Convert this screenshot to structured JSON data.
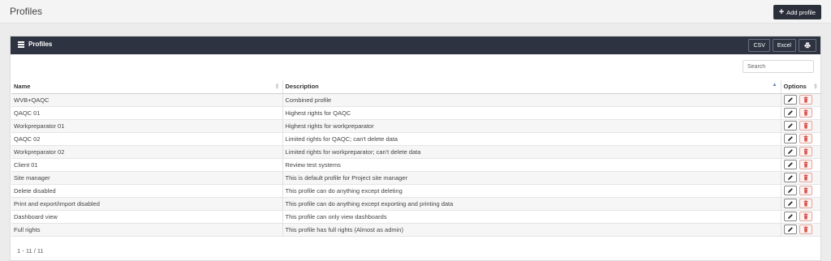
{
  "header": {
    "title": "Profiles",
    "add_button_icon": "plus-icon",
    "add_button_label": "Add profile"
  },
  "panel": {
    "title": "Profiles",
    "title_icon": "list-icon",
    "buttons": {
      "csv": "CSV",
      "excel": "Excel",
      "print_icon": "print-icon"
    }
  },
  "search": {
    "placeholder": "Search"
  },
  "table": {
    "columns": {
      "name": "Name",
      "description": "Description",
      "options": "Options"
    },
    "sorted_column": "Description",
    "rows": [
      {
        "name": "WVB+QAQC",
        "description": "Combined profile"
      },
      {
        "name": "QAQC 01",
        "description": "Highest rights for QAQC"
      },
      {
        "name": "Workpreparator 01",
        "description": "Highest rights for workpreparator"
      },
      {
        "name": "QAQC 02",
        "description": "Limited rights for QAQC; can't delete data"
      },
      {
        "name": "Workpreparator 02",
        "description": "Limited rights for workpreparator; can't delete data"
      },
      {
        "name": "Client 01",
        "description": "Review test systems"
      },
      {
        "name": "Site manager",
        "description": "This is default profile for Project site manager"
      },
      {
        "name": "Delete disabled",
        "description": "This profile can do anything except deleting"
      },
      {
        "name": "Print and export/import disabled",
        "description": "This profile can do anything except exporting and printing data"
      },
      {
        "name": "Dashboard view",
        "description": "This profile can only view dashboards"
      },
      {
        "name": "Full rights",
        "description": "This profile has full rights (Almost as admin)"
      }
    ],
    "row_actions": {
      "edit_icon": "pencil-icon",
      "delete_icon": "trash-icon"
    }
  },
  "pagination": {
    "info": "1 - 11 / 11"
  },
  "colors": {
    "dark_bar": "#2e3341",
    "delete_accent": "#d9534f",
    "page_bg": "#ececec"
  }
}
